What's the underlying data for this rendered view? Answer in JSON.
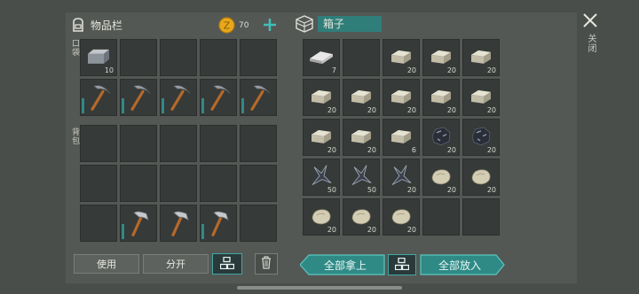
{
  "inventory": {
    "title": "物品栏",
    "coins": "70",
    "hotbar_label": "口袋",
    "backpack_label": "背包",
    "hotbar": [
      {
        "item": "iron-ingot-icon",
        "count": "10"
      },
      {
        "item": "",
        "count": ""
      },
      {
        "item": "",
        "count": ""
      },
      {
        "item": "",
        "count": ""
      },
      {
        "item": "",
        "count": ""
      },
      {
        "item": "pickaxe-icon",
        "count": "",
        "durability": true
      },
      {
        "item": "pickaxe-icon",
        "count": "",
        "durability": true
      },
      {
        "item": "pickaxe-icon",
        "count": "",
        "durability": true
      },
      {
        "item": "pickaxe-icon",
        "count": "",
        "durability": true
      },
      {
        "item": "pickaxe-icon",
        "count": "",
        "durability": true
      }
    ],
    "backpack": [
      {
        "item": "",
        "count": ""
      },
      {
        "item": "",
        "count": ""
      },
      {
        "item": "",
        "count": ""
      },
      {
        "item": "",
        "count": ""
      },
      {
        "item": "",
        "count": ""
      },
      {
        "item": "",
        "count": ""
      },
      {
        "item": "",
        "count": ""
      },
      {
        "item": "",
        "count": ""
      },
      {
        "item": "",
        "count": ""
      },
      {
        "item": "",
        "count": ""
      },
      {
        "item": "",
        "count": ""
      },
      {
        "item": "hammer-icon",
        "count": "",
        "durability": true
      },
      {
        "item": "hammer-icon",
        "count": ""
      },
      {
        "item": "hammer-icon",
        "count": "",
        "durability": true
      },
      {
        "item": "",
        "count": ""
      }
    ],
    "use_label": "使用",
    "split_label": "分开"
  },
  "box": {
    "title": "箱子",
    "close_label": "关闭",
    "take_all_label": "全部拿上",
    "put_all_label": "全部放入",
    "slots": [
      {
        "item": "metal-bar-icon",
        "count": "7"
      },
      {
        "item": "",
        "count": ""
      },
      {
        "item": "stone-brick-icon",
        "count": "20"
      },
      {
        "item": "stone-brick-icon",
        "count": "20"
      },
      {
        "item": "stone-brick-icon",
        "count": "20"
      },
      {
        "item": "stone-brick-icon",
        "count": "20"
      },
      {
        "item": "stone-brick-icon",
        "count": "20"
      },
      {
        "item": "stone-brick-icon",
        "count": "20"
      },
      {
        "item": "stone-brick-icon",
        "count": "20"
      },
      {
        "item": "stone-brick-icon",
        "count": "20"
      },
      {
        "item": "stone-brick-icon",
        "count": "20"
      },
      {
        "item": "stone-brick-icon",
        "count": "20"
      },
      {
        "item": "stone-brick-icon",
        "count": "6"
      },
      {
        "item": "coal-ore-icon",
        "count": "20"
      },
      {
        "item": "coal-ore-icon",
        "count": "20"
      },
      {
        "item": "flint-shard-icon",
        "count": "50"
      },
      {
        "item": "flint-shard-icon",
        "count": "50"
      },
      {
        "item": "flint-shard-icon",
        "count": "20"
      },
      {
        "item": "stone-chunk-icon",
        "count": "20"
      },
      {
        "item": "stone-chunk-icon",
        "count": "20"
      },
      {
        "item": "stone-chunk-icon",
        "count": "20"
      },
      {
        "item": "stone-chunk-icon",
        "count": "20"
      },
      {
        "item": "stone-chunk-icon",
        "count": "20"
      },
      {
        "item": "",
        "count": ""
      },
      {
        "item": "",
        "count": ""
      }
    ]
  },
  "colors": {
    "accent": "#3fa8a4",
    "coin": "#e8a81c"
  }
}
